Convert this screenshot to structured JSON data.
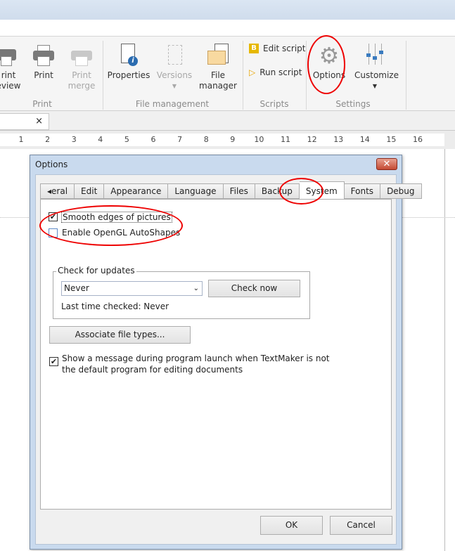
{
  "ribbon": {
    "buttons": [
      {
        "label1": "rint",
        "label2": "eview",
        "icon": "print-preview-icon",
        "enabled": true
      },
      {
        "label1": "Print",
        "label2": "",
        "icon": "printer-icon",
        "enabled": true
      },
      {
        "label1": "Print",
        "label2": "merge",
        "icon": "print-merge-icon",
        "enabled": false
      },
      {
        "label1": "Properties",
        "label2": "",
        "icon": "properties-icon",
        "enabled": true
      },
      {
        "label1": "Versions",
        "label2": "",
        "icon": "versions-icon",
        "enabled": false
      },
      {
        "label1": "File",
        "label2": "manager",
        "icon": "file-manager-icon",
        "enabled": true
      },
      {
        "label1": "Options",
        "label2": "",
        "icon": "gear-icon",
        "enabled": true
      },
      {
        "label1": "Customize",
        "label2": "",
        "icon": "sliders-icon",
        "enabled": true
      }
    ],
    "scripts": {
      "edit": "Edit script",
      "run": "Run script"
    },
    "groups": {
      "print": "Print",
      "file_management": "File management",
      "scripts": "Scripts",
      "settings": "Settings"
    }
  },
  "doc_tab": {
    "close": "×"
  },
  "ruler": [
    "1",
    "2",
    "3",
    "4",
    "5",
    "6",
    "7",
    "8",
    "9",
    "10",
    "11",
    "12",
    "13",
    "14",
    "15",
    "16"
  ],
  "dialog": {
    "title": "Options",
    "close": "✕",
    "tabs": [
      "◂eral",
      "Edit",
      "Appearance",
      "Language",
      "Files",
      "Backup",
      "System",
      "Fonts",
      "Debug"
    ],
    "active_tab": "System",
    "smooth_edges": {
      "label": "Smooth edges of pictures",
      "checked": true
    },
    "opengl": {
      "label": "Enable OpenGL AutoShapes",
      "checked": false
    },
    "updates": {
      "group": "Check for updates",
      "selected": "Never",
      "check_now": "Check now",
      "last_checked": "Last time checked: Never"
    },
    "associate": "Associate file types...",
    "show_message": {
      "line1": "Show a message during program launch when TextMaker is not",
      "line2": "the default program for editing documents",
      "checked": true
    },
    "ok": "OK",
    "cancel": "Cancel"
  },
  "annotation_color": "#e00000"
}
